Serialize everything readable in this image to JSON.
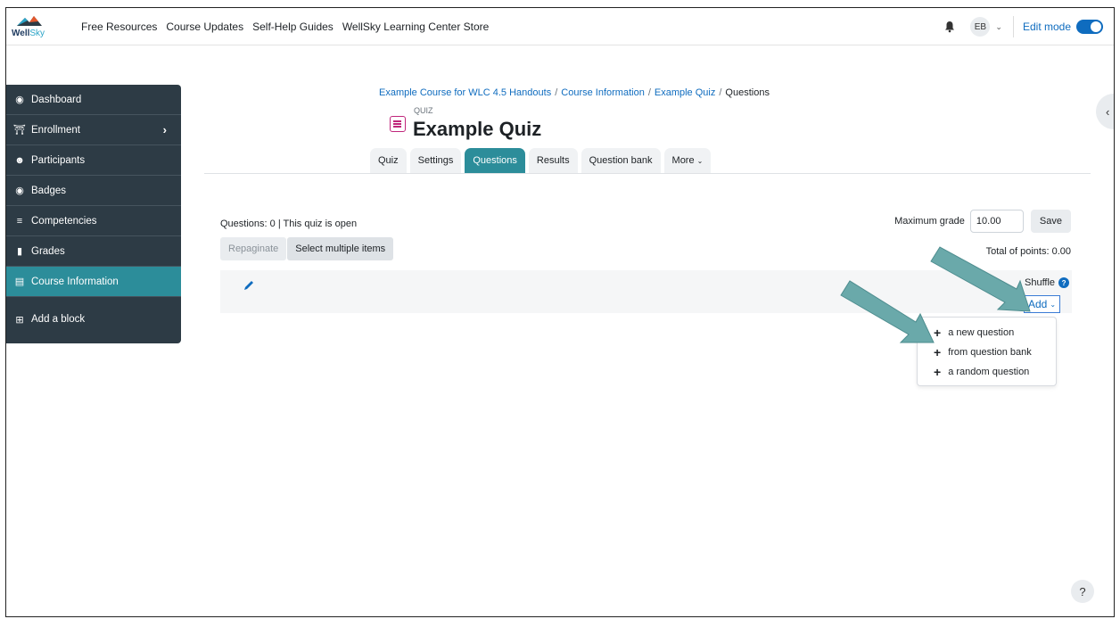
{
  "navbar": {
    "brand": "Well",
    "brand_accent": "Sky",
    "links": [
      "Free Resources",
      "Course Updates",
      "Self-Help Guides",
      "WellSky Learning Center Store"
    ],
    "user_initials": "EB",
    "edit_mode_label": "Edit mode"
  },
  "sidebar": {
    "items": [
      {
        "label": "Dashboard",
        "icon": "dashboard-icon"
      },
      {
        "label": "Enrollment",
        "icon": "bank-icon"
      },
      {
        "label": "Participants",
        "icon": "users-icon"
      },
      {
        "label": "Badges",
        "icon": "badge-icon"
      },
      {
        "label": "Competencies",
        "icon": "list-icon"
      },
      {
        "label": "Grades",
        "icon": "grades-icon"
      },
      {
        "label": "Course Information",
        "icon": "info-icon"
      },
      {
        "label": "Add a block",
        "icon": "plus-square-icon"
      }
    ]
  },
  "breadcrumb": {
    "items": [
      "Example Course for WLC 4.5 Handouts",
      "Course Information",
      "Example Quiz",
      "Questions"
    ]
  },
  "page": {
    "subtitle": "QUIZ",
    "title": "Example Quiz"
  },
  "tabs": [
    "Quiz",
    "Settings",
    "Questions",
    "Results",
    "Question bank",
    "More"
  ],
  "content": {
    "info": "Questions: 0 | This quiz is open",
    "max_grade_label": "Maximum grade",
    "max_grade_value": "10.00",
    "save_label": "Save",
    "repaginate_label": "Repaginate",
    "select_multiple_label": "Select multiple items",
    "total_points": "Total of points: 0.00",
    "shuffle_label": "Shuffle",
    "add_label": "Add"
  },
  "add_menu": {
    "items": [
      "a new question",
      "from question bank",
      "a random question"
    ]
  },
  "colors": {
    "accent_teal": "#2c8d9a",
    "sidebar_bg": "#2d3b45",
    "link_blue": "#0f6cbf",
    "arrow_teal": "#6aa9aa"
  }
}
